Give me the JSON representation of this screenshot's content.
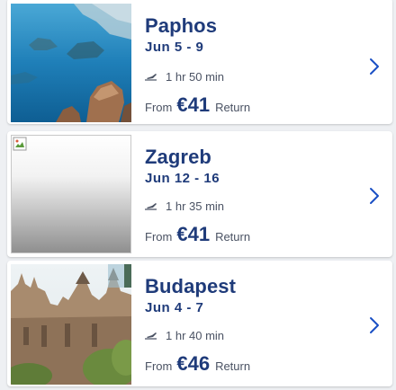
{
  "destinations": [
    {
      "city": "Paphos",
      "dates": "Jun 5 - 9",
      "duration": "1 hr 50 min",
      "from_label": "From",
      "price": "€41",
      "trip_type": "Return",
      "image": "coastline-photo"
    },
    {
      "city": "Zagreb",
      "dates": "Jun 12 - 16",
      "duration": "1 hr 35 min",
      "from_label": "From",
      "price": "€41",
      "trip_type": "Return",
      "image": "broken-image-placeholder"
    },
    {
      "city": "Budapest",
      "dates": "Jun 4 - 7",
      "duration": "1 hr 40 min",
      "from_label": "From",
      "price": "€46",
      "trip_type": "Return",
      "image": "castle-photo"
    }
  ],
  "icons": {
    "flight": "plane-icon",
    "chevron": "chevron-right-icon"
  },
  "colors": {
    "brand_navy": "#1f3b7a",
    "accent_blue": "#1a4fc4",
    "muted_text": "#4a5263",
    "background": "#eef0f3"
  }
}
